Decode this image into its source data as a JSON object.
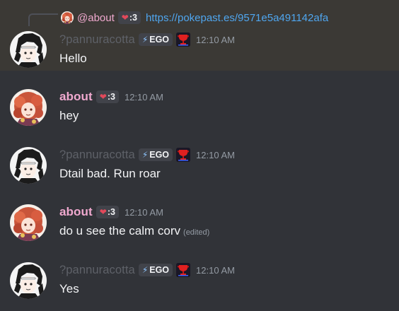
{
  "reply": {
    "name": "@about",
    "tag_text": ":3",
    "link_text": "https://pokepast.es/9571e5a491142afa"
  },
  "messages": [
    {
      "author": "?pannuracotta",
      "tag_text": "EGO",
      "time": "12:10 AM",
      "text": "Hello",
      "highlighted": true
    },
    {
      "author": "about",
      "tag_text": ":3",
      "time": "12:10 AM",
      "text": "hey"
    },
    {
      "author": "?pannuracotta",
      "tag_text": "EGO",
      "time": "12:10 AM",
      "text": "Dtail bad. Run roar"
    },
    {
      "author": "about",
      "tag_text": ":3",
      "time": "12:10 AM",
      "text": "do u see the calm corv",
      "edited": "(edited)"
    },
    {
      "author": "?pannuracotta",
      "tag_text": "EGO",
      "time": "12:10 AM",
      "text": "Yes"
    }
  ],
  "colors": {
    "background": "#313338",
    "highlight": "#3b3935",
    "about_name": "#f0a9cf",
    "pannu_name": "#5e6168",
    "link": "#4fa6ef"
  },
  "icons": {
    "about_tag": "heart-icon",
    "pannu_tag": "lightning-icon",
    "pannu_role": "trophy-icon"
  }
}
